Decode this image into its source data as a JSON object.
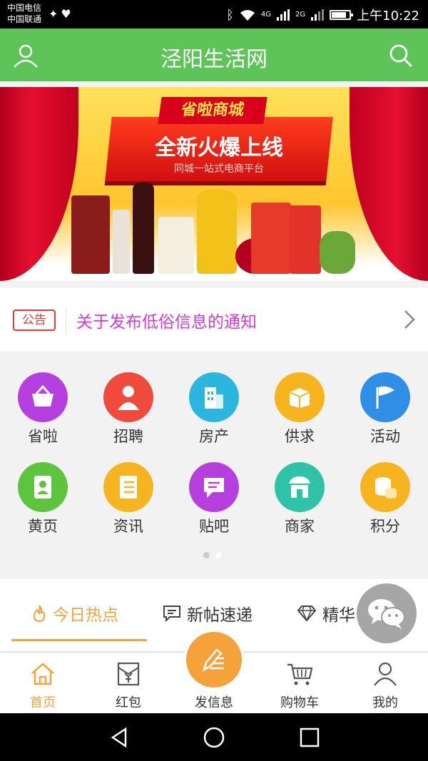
{
  "status_bar": {
    "carrier_1": "中国电信",
    "carrier_2": "中国联通",
    "network_1": "4G",
    "network_2": "2G",
    "time": "上午10:22"
  },
  "header": {
    "title": "泾阳生活网",
    "user_icon": "user-icon",
    "search_icon": "search-icon",
    "color": "#5ec358"
  },
  "banner": {
    "brand": "省啦商城",
    "headline": "全新火爆上线",
    "subline": "同城一站式电商平台"
  },
  "notice": {
    "tag": "公告",
    "text": "关于发布低俗信息的通知",
    "text_color": "#d33ad5"
  },
  "categories": [
    {
      "label": "省啦",
      "icon": "basket-icon",
      "color": "#b63fe0"
    },
    {
      "label": "招聘",
      "icon": "person-icon",
      "color": "#ef4a3b"
    },
    {
      "label": "房产",
      "icon": "building-icon",
      "color": "#2bb6e0"
    },
    {
      "label": "供求",
      "icon": "box-icon",
      "color": "#f6b51f"
    },
    {
      "label": "活动",
      "icon": "flag-icon",
      "color": "#2f8ee6"
    },
    {
      "label": "黄页",
      "icon": "contact-book-icon",
      "color": "#5cc43d"
    },
    {
      "label": "资讯",
      "icon": "news-icon",
      "color": "#f6b51f"
    },
    {
      "label": "贴吧",
      "icon": "message-icon",
      "color": "#b63fe0"
    },
    {
      "label": "商家",
      "icon": "store-icon",
      "color": "#2ec2a6"
    },
    {
      "label": "积分",
      "icon": "coins-icon",
      "color": "#f6b51f"
    }
  ],
  "tabs": [
    {
      "label": "今日热点",
      "icon": "fire-icon"
    },
    {
      "label": "新帖速递",
      "icon": "comment-icon"
    },
    {
      "label": "精华",
      "icon": "diamond-icon"
    }
  ],
  "bottom_nav": [
    {
      "label": "首页",
      "icon": "home-icon"
    },
    {
      "label": "红包",
      "icon": "red-envelope-icon"
    },
    {
      "label": "发信息",
      "icon": "pen-icon"
    },
    {
      "label": "购物车",
      "icon": "cart-icon"
    },
    {
      "label": "我的",
      "icon": "user-icon"
    }
  ],
  "accent_color": "#f5a23a"
}
